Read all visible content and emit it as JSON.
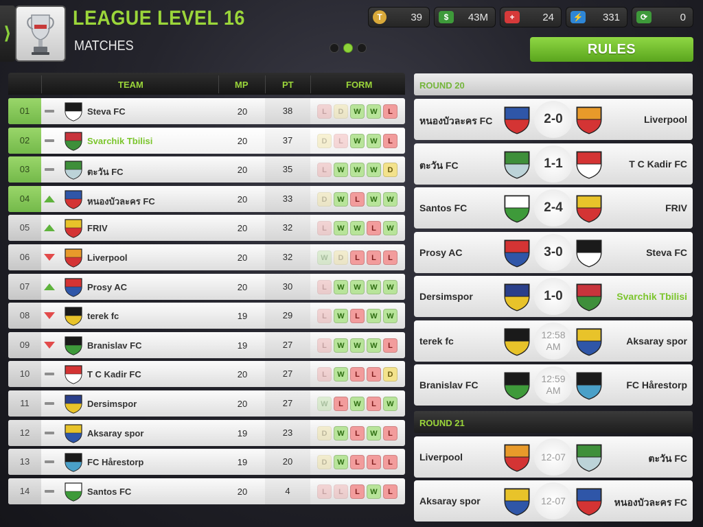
{
  "header": {
    "back_glyph": "⟩",
    "title": "LEAGUE LEVEL 16",
    "subtitle": "MATCHES",
    "trophy_icon": "trophy-icon",
    "pager_active": 1,
    "rules_label": "RULES"
  },
  "currencies": [
    {
      "icon": "token-icon",
      "value": "39",
      "color": "#d9a93a"
    },
    {
      "icon": "cash-icon",
      "value": "43M",
      "color": "#3e9a3a"
    },
    {
      "icon": "medical-icon",
      "value": "24",
      "color": "#d63a3a"
    },
    {
      "icon": "energy-icon",
      "value": "331",
      "color": "#2e86d6"
    },
    {
      "icon": "money-transfer-icon",
      "value": "0",
      "color": "#3e9a3a"
    }
  ],
  "table": {
    "headers": {
      "team": "TEAM",
      "mp": "MP",
      "pt": "PT",
      "form": "FORM"
    },
    "rows": [
      {
        "pos": "01",
        "trend": "same",
        "team": "Steva FC",
        "mp": "20",
        "pt": "38",
        "form": [
          "L",
          "D",
          "W",
          "W",
          "L"
        ],
        "faded": 2,
        "crest": [
          "#1a1a1a",
          "#ffffff"
        ],
        "promo": true,
        "active": false
      },
      {
        "pos": "02",
        "trend": "same",
        "team": "Svarchik Tbilisi",
        "mp": "20",
        "pt": "37",
        "form": [
          "D",
          "L",
          "W",
          "W",
          "L"
        ],
        "faded": 2,
        "crest": [
          "#c8343c",
          "#3e8f3a"
        ],
        "promo": true,
        "active": true
      },
      {
        "pos": "03",
        "trend": "same",
        "team": "ตะวัน FC",
        "mp": "20",
        "pt": "35",
        "form": [
          "L",
          "W",
          "W",
          "W",
          "D"
        ],
        "faded": 1,
        "crest": [
          "#3e8f3a",
          "#bcd3d8"
        ],
        "promo": true,
        "active": false
      },
      {
        "pos": "04",
        "trend": "up",
        "team": "หนองบัวละคร FC",
        "mp": "20",
        "pt": "33",
        "form": [
          "D",
          "W",
          "L",
          "W",
          "W"
        ],
        "faded": 1,
        "crest": [
          "#2f56a8",
          "#d43434"
        ],
        "promo": true,
        "active": false
      },
      {
        "pos": "05",
        "trend": "up",
        "team": "FRIV",
        "mp": "20",
        "pt": "32",
        "form": [
          "L",
          "W",
          "W",
          "L",
          "W"
        ],
        "faded": 1,
        "crest": [
          "#e8c32a",
          "#d43434"
        ],
        "promo": false,
        "active": false
      },
      {
        "pos": "06",
        "trend": "down",
        "team": "Liverpool",
        "mp": "20",
        "pt": "32",
        "form": [
          "W",
          "D",
          "L",
          "L",
          "L"
        ],
        "faded": 2,
        "crest": [
          "#e89a2a",
          "#d43434"
        ],
        "promo": false,
        "active": false
      },
      {
        "pos": "07",
        "trend": "up",
        "team": "Prosy AC",
        "mp": "20",
        "pt": "30",
        "form": [
          "L",
          "W",
          "W",
          "W",
          "W"
        ],
        "faded": 1,
        "crest": [
          "#d43434",
          "#2f56a8"
        ],
        "promo": false,
        "active": false
      },
      {
        "pos": "08",
        "trend": "down",
        "team": "terek fc",
        "mp": "19",
        "pt": "29",
        "form": [
          "L",
          "W",
          "L",
          "W",
          "W"
        ],
        "faded": 1,
        "crest": [
          "#1a1a1a",
          "#e8c32a"
        ],
        "promo": false,
        "active": false
      },
      {
        "pos": "09",
        "trend": "down",
        "team": "Branislav FC",
        "mp": "19",
        "pt": "27",
        "form": [
          "L",
          "W",
          "W",
          "W",
          "L"
        ],
        "faded": 1,
        "crest": [
          "#1a1a1a",
          "#3e9a3a"
        ],
        "promo": false,
        "active": false
      },
      {
        "pos": "10",
        "trend": "same",
        "team": "T C Kadir FC",
        "mp": "20",
        "pt": "27",
        "form": [
          "L",
          "W",
          "L",
          "L",
          "D"
        ],
        "faded": 1,
        "crest": [
          "#d43434",
          "#ffffff"
        ],
        "promo": false,
        "active": false
      },
      {
        "pos": "11",
        "trend": "same",
        "team": "Dersimspor",
        "mp": "20",
        "pt": "27",
        "form": [
          "W",
          "L",
          "W",
          "L",
          "W"
        ],
        "faded": 1,
        "crest": [
          "#2a3f8a",
          "#e8c32a"
        ],
        "promo": false,
        "active": false
      },
      {
        "pos": "12",
        "trend": "same",
        "team": "Aksaray spor",
        "mp": "19",
        "pt": "23",
        "form": [
          "D",
          "W",
          "L",
          "W",
          "L"
        ],
        "faded": 1,
        "crest": [
          "#e8c32a",
          "#2f56a8"
        ],
        "promo": false,
        "active": false
      },
      {
        "pos": "13",
        "trend": "same",
        "team": "FC Hårestorp",
        "mp": "19",
        "pt": "20",
        "form": [
          "D",
          "W",
          "L",
          "L",
          "L"
        ],
        "faded": 1,
        "crest": [
          "#1a1a1a",
          "#4aa0c8"
        ],
        "promo": false,
        "active": false
      },
      {
        "pos": "14",
        "trend": "same",
        "team": "Santos FC",
        "mp": "20",
        "pt": "4",
        "form": [
          "L",
          "L",
          "L",
          "W",
          "L"
        ],
        "faded": 2,
        "crest": [
          "#ffffff",
          "#3e9a3a"
        ],
        "promo": false,
        "active": false
      }
    ]
  },
  "rounds": [
    {
      "label": "ROUND 20",
      "matches": [
        {
          "home": "หนองบัวละคร FC",
          "away": "Liverpool",
          "result": "2-0",
          "kind": "score",
          "home_crest": [
            "#2f56a8",
            "#d43434"
          ],
          "away_crest": [
            "#e89a2a",
            "#d43434"
          ],
          "away_hl": false
        },
        {
          "home": "ตะวัน FC",
          "away": "T C Kadir FC",
          "result": "1-1",
          "kind": "score",
          "home_crest": [
            "#3e8f3a",
            "#bcd3d8"
          ],
          "away_crest": [
            "#d43434",
            "#ffffff"
          ],
          "away_hl": false
        },
        {
          "home": "Santos FC",
          "away": "FRIV",
          "result": "2-4",
          "kind": "score",
          "home_crest": [
            "#ffffff",
            "#3e9a3a"
          ],
          "away_crest": [
            "#e8c32a",
            "#d43434"
          ],
          "away_hl": false
        },
        {
          "home": "Prosy AC",
          "away": "Steva FC",
          "result": "3-0",
          "kind": "score",
          "home_crest": [
            "#d43434",
            "#2f56a8"
          ],
          "away_crest": [
            "#1a1a1a",
            "#ffffff"
          ],
          "away_hl": false
        },
        {
          "home": "Dersimspor",
          "away": "Svarchik Tbilisi",
          "result": "1-0",
          "kind": "score",
          "home_crest": [
            "#2a3f8a",
            "#e8c32a"
          ],
          "away_crest": [
            "#c8343c",
            "#3e8f3a"
          ],
          "away_hl": true
        },
        {
          "home": "terek fc",
          "away": "Aksaray spor",
          "result": "12:58 AM",
          "kind": "time",
          "home_crest": [
            "#1a1a1a",
            "#e8c32a"
          ],
          "away_crest": [
            "#e8c32a",
            "#2f56a8"
          ],
          "away_hl": false
        },
        {
          "home": "Branislav FC",
          "away": "FC Hårestorp",
          "result": "12:59 AM",
          "kind": "time",
          "home_crest": [
            "#1a1a1a",
            "#3e9a3a"
          ],
          "away_crest": [
            "#1a1a1a",
            "#4aa0c8"
          ],
          "away_hl": false
        }
      ]
    },
    {
      "label": "ROUND 21",
      "matches": [
        {
          "home": "Liverpool",
          "away": "ตะวัน FC",
          "result": "12-07",
          "kind": "date",
          "home_crest": [
            "#e89a2a",
            "#d43434"
          ],
          "away_crest": [
            "#3e8f3a",
            "#bcd3d8"
          ],
          "away_hl": false
        },
        {
          "home": "Aksaray spor",
          "away": "หนองบัวละคร FC",
          "result": "12-07",
          "kind": "date",
          "home_crest": [
            "#e8c32a",
            "#2f56a8"
          ],
          "away_crest": [
            "#2f56a8",
            "#d43434"
          ],
          "away_hl": false
        }
      ]
    }
  ]
}
